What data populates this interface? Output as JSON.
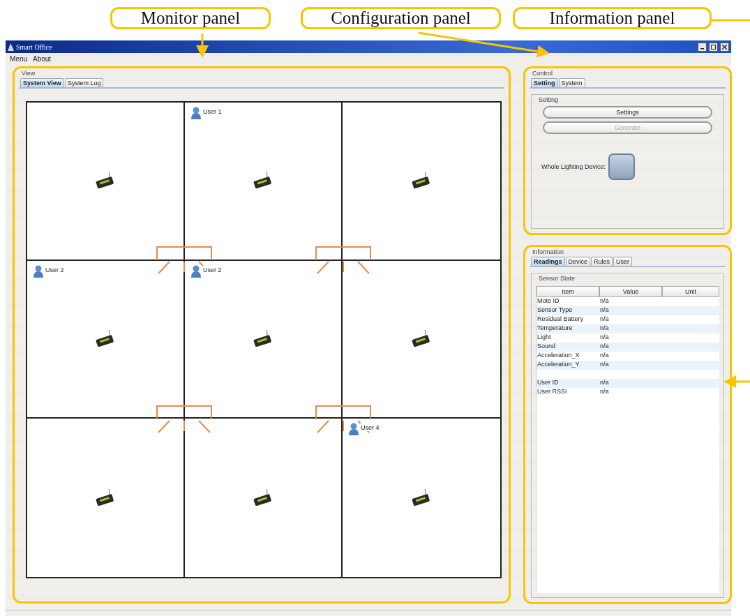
{
  "callouts": [
    {
      "label": "Monitor panel"
    },
    {
      "label": "Configuration panel"
    },
    {
      "label": "Information panel"
    }
  ],
  "window": {
    "title": "Smart Office"
  },
  "menu": [
    {
      "label": "Menu"
    },
    {
      "label": "About"
    }
  ],
  "view": {
    "title": "View",
    "tabs": [
      {
        "label": "System View",
        "selected": true
      },
      {
        "label": "System Log",
        "selected": false
      }
    ],
    "rooms": [
      {
        "kind": "empty"
      },
      {
        "kind": "occupied",
        "user": "User 1"
      },
      {
        "kind": "empty"
      },
      {
        "kind": "occupied",
        "user": "User 2"
      },
      {
        "kind": "occupied",
        "user": "User 2"
      },
      {
        "kind": "empty"
      },
      {
        "kind": "empty"
      },
      {
        "kind": "empty"
      },
      {
        "kind": "occupied",
        "user": "User 4"
      }
    ]
  },
  "control": {
    "title": "Control",
    "tabs": [
      {
        "label": "Setting",
        "selected": true
      },
      {
        "label": "System",
        "selected": false
      }
    ],
    "group": "Setting",
    "buttons": [
      {
        "label": "Settings",
        "disabled": false
      },
      {
        "label": "Generate",
        "disabled": true
      }
    ],
    "toggle_label": "Whole Lighting Device:"
  },
  "information": {
    "title": "Information",
    "tabs": [
      {
        "label": "Readings",
        "selected": true
      },
      {
        "label": "Device",
        "selected": false
      },
      {
        "label": "Rules",
        "selected": false
      },
      {
        "label": "User",
        "selected": false
      }
    ],
    "group": "Sensor State",
    "columns": [
      "Item",
      "Value",
      "Unit"
    ],
    "rows": [
      {
        "kind": "reading",
        "item": "Mote ID",
        "value": "n/a"
      },
      {
        "kind": "reading",
        "item": "Sensor Type",
        "value": "n/a"
      },
      {
        "kind": "reading",
        "item": "Residual Battery",
        "value": "n/a"
      },
      {
        "kind": "reading",
        "item": "Temperature",
        "value": "n/a"
      },
      {
        "kind": "reading",
        "item": "Light",
        "value": "n/a"
      },
      {
        "kind": "reading",
        "item": "Sound",
        "value": "n/a"
      },
      {
        "kind": "reading",
        "item": "Acceleration_X",
        "value": "n/a"
      },
      {
        "kind": "reading",
        "item": "Acceleration_Y",
        "value": "n/a"
      },
      {
        "kind": "blank"
      },
      {
        "kind": "reading",
        "item": "User ID",
        "value": "n/a"
      },
      {
        "kind": "reading",
        "item": "User RSSI",
        "value": "n/a"
      }
    ]
  }
}
